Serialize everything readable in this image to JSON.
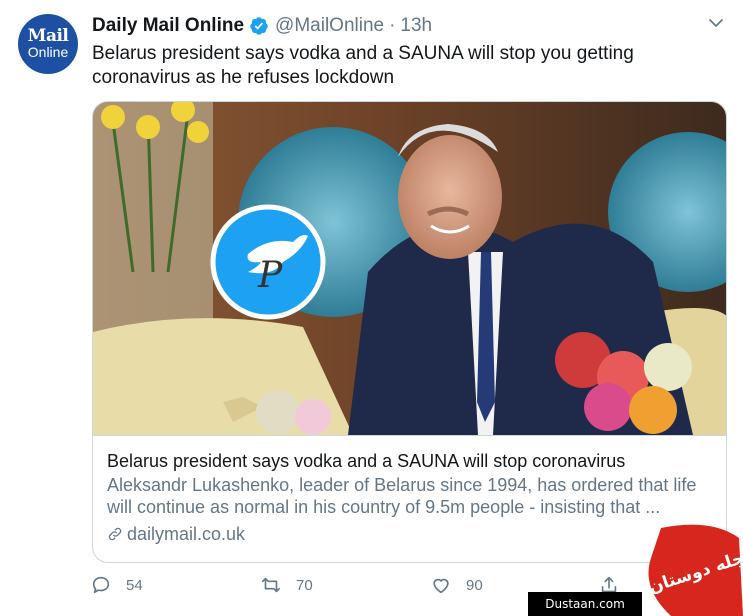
{
  "author": {
    "name": "Daily Mail Online",
    "handle": "@MailOnline",
    "separator": "·",
    "time": "13h",
    "avatar_line1": "Mail",
    "avatar_line2": "Online"
  },
  "tweet": {
    "text": "Belarus president says vodka and a SAUNA will stop you getting coronavirus as he refuses lockdown"
  },
  "card": {
    "title": "Belarus president says vodka and a SAUNA will stop coronavirus",
    "description": "Aleksandr Lukashenko, leader of Belarus since 1994, has ordered that life will continue as normal in his country of 9.5m people - insisting that ...",
    "domain": "dailymail.co.uk"
  },
  "actions": {
    "replies": "54",
    "retweets": "70",
    "likes": "90"
  },
  "watermark": {
    "site": "Dustaan.com",
    "logo_text": "مجله دوستان"
  },
  "colors": {
    "text": "#14171a",
    "muted": "#657786",
    "border": "#ccd6dd",
    "verified": "#1da1f2",
    "avatar_bg": "#1d4fa3",
    "watermark_red": "#d7261e"
  }
}
